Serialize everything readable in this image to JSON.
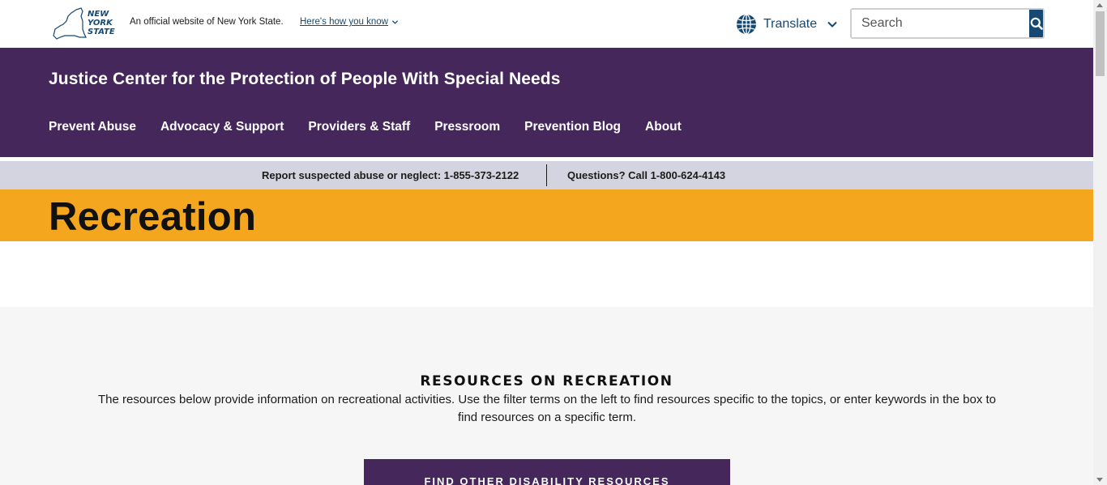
{
  "nys_bar": {
    "logo_lines": [
      "NEW",
      "YORK",
      "STATE"
    ],
    "official_text": "An official website of New York State.",
    "how_know_link": "Here's how you know",
    "translate_label": "Translate",
    "search_placeholder": "Search"
  },
  "header": {
    "agency_title": "Justice Center for the Protection of People With Special Needs",
    "nav": [
      "Prevent Abuse",
      "Advocacy & Support",
      "Providers & Staff",
      "Pressroom",
      "Prevention Blog",
      "About"
    ]
  },
  "hotline": {
    "report": "Report suspected abuse or neglect: 1-855-373-2122",
    "questions": "Questions? Call 1-800-624-4143"
  },
  "page": {
    "title": "Recreation"
  },
  "content": {
    "heading": "RESOURCES ON RECREATION",
    "description": "The resources below provide information on recreational activities. Use the filter terms on the left to find resources specific to the topics, or enter keywords in the box to find resources on a specific term.",
    "find_button": "FIND OTHER DISABILITY RESOURCES"
  },
  "colors": {
    "nys_blue": "#154973",
    "purple": "#45275c",
    "orange": "#f4a71e",
    "hotline_gray": "#d4d4e0"
  },
  "icons": [
    "nys-logo-icon",
    "chevron-down-icon",
    "globe-icon",
    "search-icon"
  ]
}
